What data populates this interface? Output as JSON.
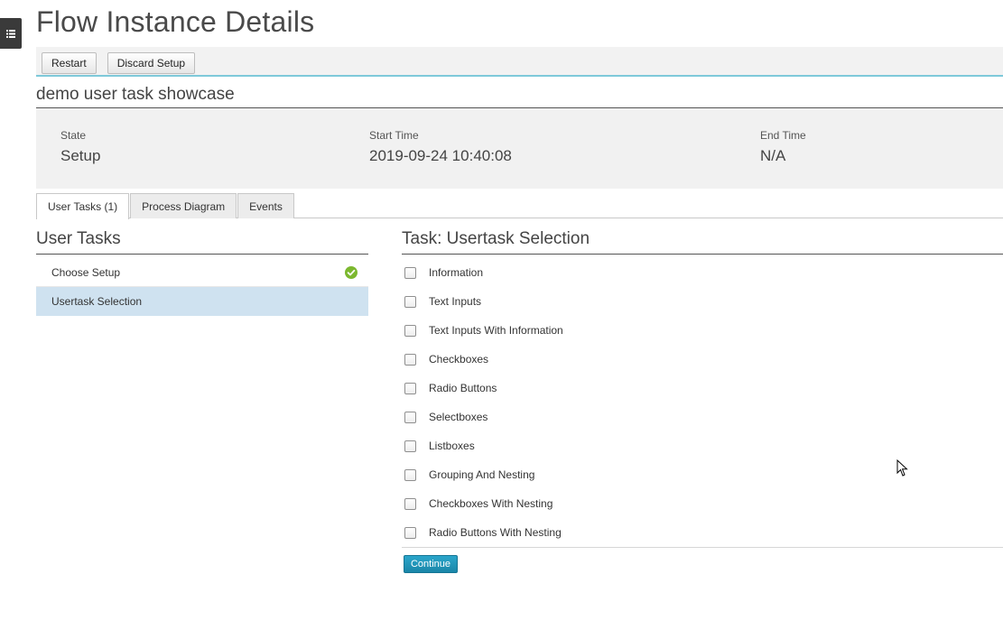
{
  "page": {
    "title": "Flow Instance Details"
  },
  "sidebar_toggle": {
    "icon": "list-icon"
  },
  "toolbar": {
    "restart_label": "Restart",
    "discard_label": "Discard Setup"
  },
  "instance": {
    "name": "demo user task showcase",
    "state_label": "State",
    "state_value": "Setup",
    "start_label": "Start Time",
    "start_value": "2019-09-24 10:40:08",
    "end_label": "End Time",
    "end_value": "N/A"
  },
  "tabs": [
    {
      "label": "User Tasks (1)",
      "active": true
    },
    {
      "label": "Process Diagram",
      "active": false
    },
    {
      "label": "Events",
      "active": false
    }
  ],
  "user_tasks": {
    "title": "User Tasks",
    "items": [
      {
        "label": "Choose Setup",
        "completed": true,
        "icon": "check-circle-icon"
      },
      {
        "label": "Usertask Selection",
        "completed": false,
        "selected": true
      }
    ]
  },
  "task_panel": {
    "title": "Task: Usertask Selection",
    "options": [
      "Information",
      "Text Inputs",
      "Text Inputs With Information",
      "Checkboxes",
      "Radio Buttons",
      "Selectboxes",
      "Listboxes",
      "Grouping And Nesting",
      "Checkboxes With Nesting",
      "Radio Buttons With Nesting"
    ],
    "continue_label": "Continue"
  },
  "colors": {
    "accent": "#2ba6cb",
    "selected_row": "#cfe2f0",
    "success": "#7cb82f",
    "toolbar_border": "#7ec9d9"
  }
}
